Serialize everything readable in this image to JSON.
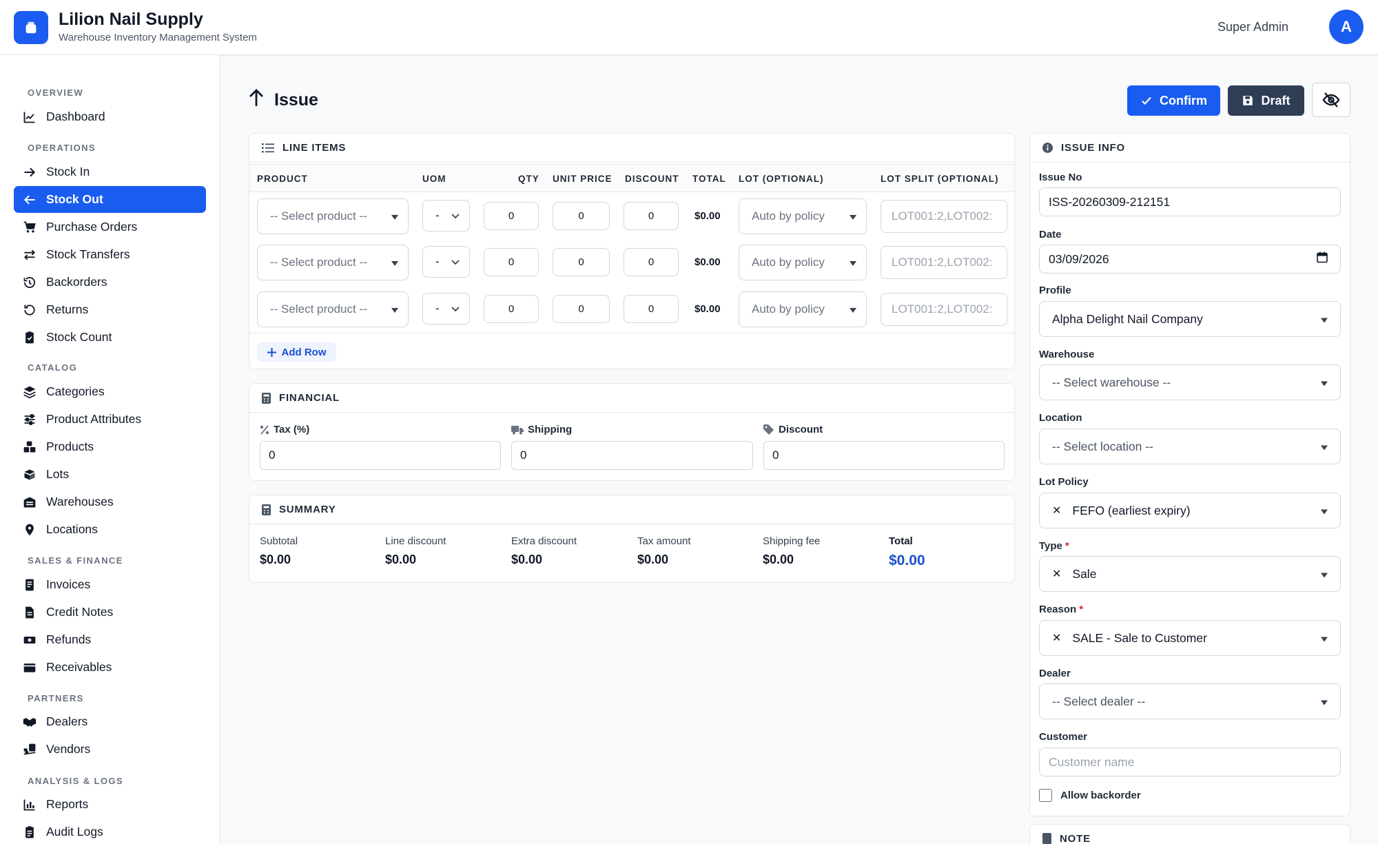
{
  "header": {
    "app_title": "Lilion Nail Supply",
    "app_subtitle": "Warehouse Inventory Management System",
    "user_name": "Super Admin",
    "avatar_initial": "A"
  },
  "sidebar": {
    "sections": [
      {
        "title": "OVERVIEW",
        "items": [
          {
            "label": "Dashboard",
            "icon": "chart-line-icon"
          }
        ]
      },
      {
        "title": "OPERATIONS",
        "items": [
          {
            "label": "Stock In",
            "icon": "arrow-right-icon"
          },
          {
            "label": "Stock Out",
            "icon": "arrow-left-icon",
            "active": true
          },
          {
            "label": "Purchase Orders",
            "icon": "cart-icon"
          },
          {
            "label": "Stock Transfers",
            "icon": "swap-arrows-icon"
          },
          {
            "label": "Backorders",
            "icon": "history-icon"
          },
          {
            "label": "Returns",
            "icon": "undo-icon"
          },
          {
            "label": "Stock Count",
            "icon": "clipboard-check-icon"
          }
        ]
      },
      {
        "title": "CATALOG",
        "items": [
          {
            "label": "Categories",
            "icon": "layers-icon"
          },
          {
            "label": "Product Attributes",
            "icon": "sliders-icon"
          },
          {
            "label": "Products",
            "icon": "boxes-icon"
          },
          {
            "label": "Lots",
            "icon": "box-open-icon"
          },
          {
            "label": "Warehouses",
            "icon": "warehouse-icon"
          },
          {
            "label": "Locations",
            "icon": "map-pin-icon"
          }
        ]
      },
      {
        "title": "SALES & FINANCE",
        "items": [
          {
            "label": "Invoices",
            "icon": "invoice-icon"
          },
          {
            "label": "Credit Notes",
            "icon": "file-invoice-icon"
          },
          {
            "label": "Refunds",
            "icon": "money-refund-icon"
          },
          {
            "label": "Receivables",
            "icon": "wallet-icon"
          }
        ]
      },
      {
        "title": "PARTNERS",
        "items": [
          {
            "label": "Dealers",
            "icon": "handshake-icon"
          },
          {
            "label": "Vendors",
            "icon": "truck-ramp-icon"
          }
        ]
      },
      {
        "title": "ANALYSIS & LOGS",
        "items": [
          {
            "label": "Reports",
            "icon": "bar-chart-icon"
          },
          {
            "label": "Audit Logs",
            "icon": "clipboard-list-icon"
          }
        ]
      }
    ]
  },
  "page": {
    "title": "Issue",
    "confirm_label": "Confirm",
    "draft_label": "Draft"
  },
  "line_items": {
    "title": "LINE ITEMS",
    "columns": [
      "PRODUCT",
      "UOM",
      "QTY",
      "UNIT PRICE",
      "DISCOUNT",
      "TOTAL",
      "LOT (OPTIONAL)",
      "LOT SPLIT (OPTIONAL)"
    ],
    "rows": [
      {
        "product": "-- Select product --",
        "uom": "-",
        "qty": "0",
        "unit_price": "0",
        "discount": "0",
        "total": "$0.00",
        "lot": "Auto by policy",
        "lot_split_placeholder": "LOT001:2,LOT002:"
      },
      {
        "product": "-- Select product --",
        "uom": "-",
        "qty": "0",
        "unit_price": "0",
        "discount": "0",
        "total": "$0.00",
        "lot": "Auto by policy",
        "lot_split_placeholder": "LOT001:2,LOT002:"
      },
      {
        "product": "-- Select product --",
        "uom": "-",
        "qty": "0",
        "unit_price": "0",
        "discount": "0",
        "total": "$0.00",
        "lot": "Auto by policy",
        "lot_split_placeholder": "LOT001:2,LOT002:"
      }
    ],
    "add_row_label": "Add Row"
  },
  "financial": {
    "title": "FINANCIAL",
    "tax_label": "Tax (%)",
    "tax_value": "0",
    "shipping_label": "Shipping",
    "shipping_value": "0",
    "discount_label": "Discount",
    "discount_value": "0"
  },
  "summary": {
    "title": "SUMMARY",
    "items": [
      {
        "label": "Subtotal",
        "value": "$0.00"
      },
      {
        "label": "Line discount",
        "value": "$0.00"
      },
      {
        "label": "Extra discount",
        "value": "$0.00"
      },
      {
        "label": "Tax amount",
        "value": "$0.00"
      },
      {
        "label": "Shipping fee",
        "value": "$0.00"
      }
    ],
    "total_label": "Total",
    "total_value": "$0.00"
  },
  "issue_info": {
    "title": "ISSUE INFO",
    "issue_no_label": "Issue No",
    "issue_no_value": "ISS-20260309-212151",
    "date_label": "Date",
    "date_value": "03/09/2026",
    "profile_label": "Profile",
    "profile_value": "Alpha Delight Nail Company",
    "warehouse_label": "Warehouse",
    "warehouse_value": "-- Select warehouse --",
    "location_label": "Location",
    "location_value": "-- Select location --",
    "lot_policy_label": "Lot Policy",
    "lot_policy_value": "FEFO (earliest expiry)",
    "type_label": "Type",
    "type_value": "Sale",
    "reason_label": "Reason",
    "reason_value": "SALE - Sale to Customer",
    "dealer_label": "Dealer",
    "dealer_value": "-- Select dealer --",
    "customer_label": "Customer",
    "customer_placeholder": "Customer name",
    "allow_backorder_label": "Allow backorder",
    "required_mark": "*"
  },
  "note": {
    "title": "NOTE"
  },
  "colors": {
    "accent": "#1a5cf0",
    "dark_button": "#2f3e55",
    "total_text": "#1a4fd0",
    "required": "#dc2626"
  }
}
